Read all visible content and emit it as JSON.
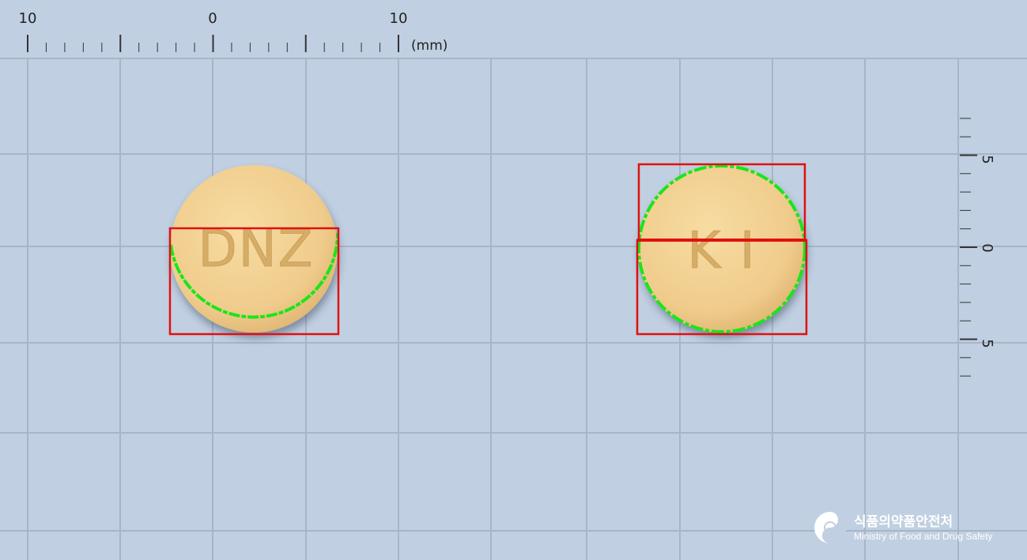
{
  "ruler_top": {
    "labels": [
      "10",
      "0",
      "10"
    ],
    "unit": "(mm)"
  },
  "ruler_right": {
    "labels": [
      "5",
      "0",
      "5"
    ]
  },
  "tablets": [
    {
      "side": "front",
      "imprint": "DNZ",
      "color": "#f2cf8f"
    },
    {
      "side": "back",
      "imprint": "K I",
      "color": "#f2cf8f"
    }
  ],
  "colors": {
    "background": "#c0cfe1",
    "grid_line": "#a6b6c8",
    "detection_box": "#e01010",
    "contour": "#19e619"
  },
  "logo": {
    "icon": "taegeuk-icon",
    "name_ko": "식품의약품안전처",
    "name_en": "Ministry of Food and Drug Safety"
  }
}
